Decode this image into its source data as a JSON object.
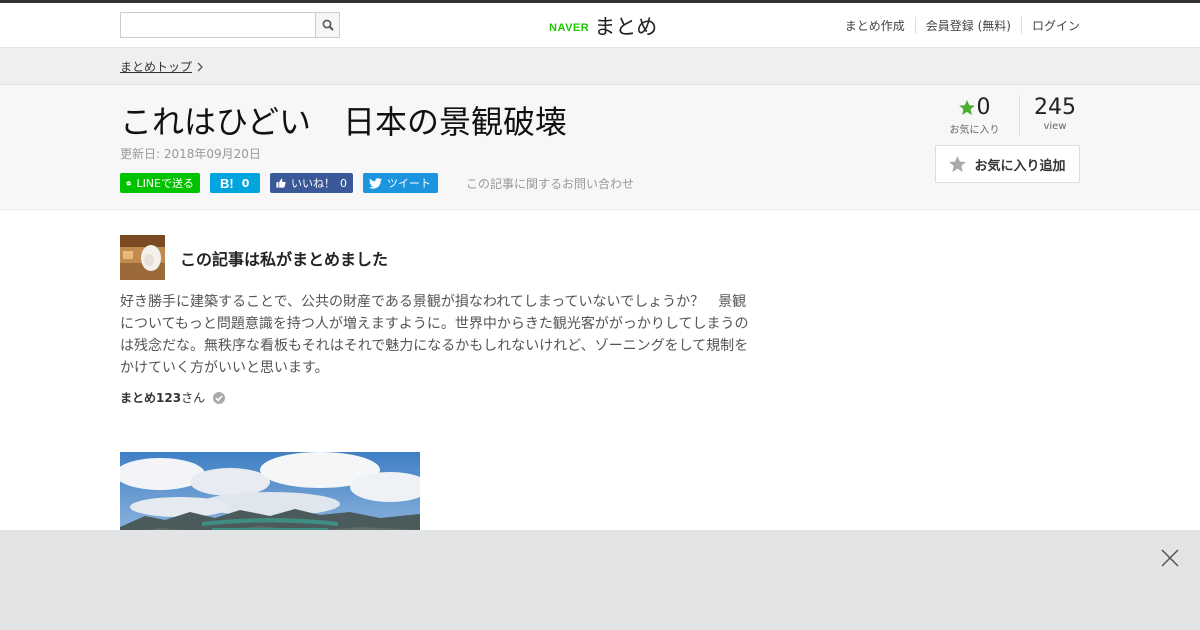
{
  "header": {
    "brand_naver": "NAVER",
    "brand_matome": "まとめ",
    "nav": [
      "まとめ作成",
      "会員登録 (無料)",
      "ログイン"
    ]
  },
  "breadcrumb": {
    "top": "まとめトップ"
  },
  "article": {
    "title": "これはひどい　日本の景観破壊",
    "updated": "更新日: 2018年09月20日",
    "share": {
      "line": "LINEで送る",
      "hatena_count": "0",
      "fb_label": "いいね！",
      "fb_count": "0",
      "tweet": "ツイート"
    },
    "inquiry": "この記事に関するお問い合わせ",
    "favorites": {
      "count": "0",
      "label": "お気に入り"
    },
    "views": {
      "count": "245",
      "label": "view"
    },
    "fav_button": "お気に入り追加"
  },
  "author": {
    "heading": "この記事は私がまとめました",
    "description": "好き勝手に建築することで、公共の財産である景観が損なわれてしまっていないでしょうか？　景観についてもっと問題意識を持つ人が増えますように。世界中からきた観光客ががっかりしてしまうのは残念だな。無秩序な看板もそれはそれで魅力になるかもしれないけれど、ゾーニングをして規制をかけていく方がいいと思います。",
    "name": "まとめ123",
    "suffix": "さん"
  },
  "colors": {
    "line": "#00c300",
    "hatena": "#00a4de",
    "facebook": "#3b5998",
    "twitter": "#1b95e0",
    "naver_green": "#1ec800",
    "fav_star": "#4cae2f"
  }
}
